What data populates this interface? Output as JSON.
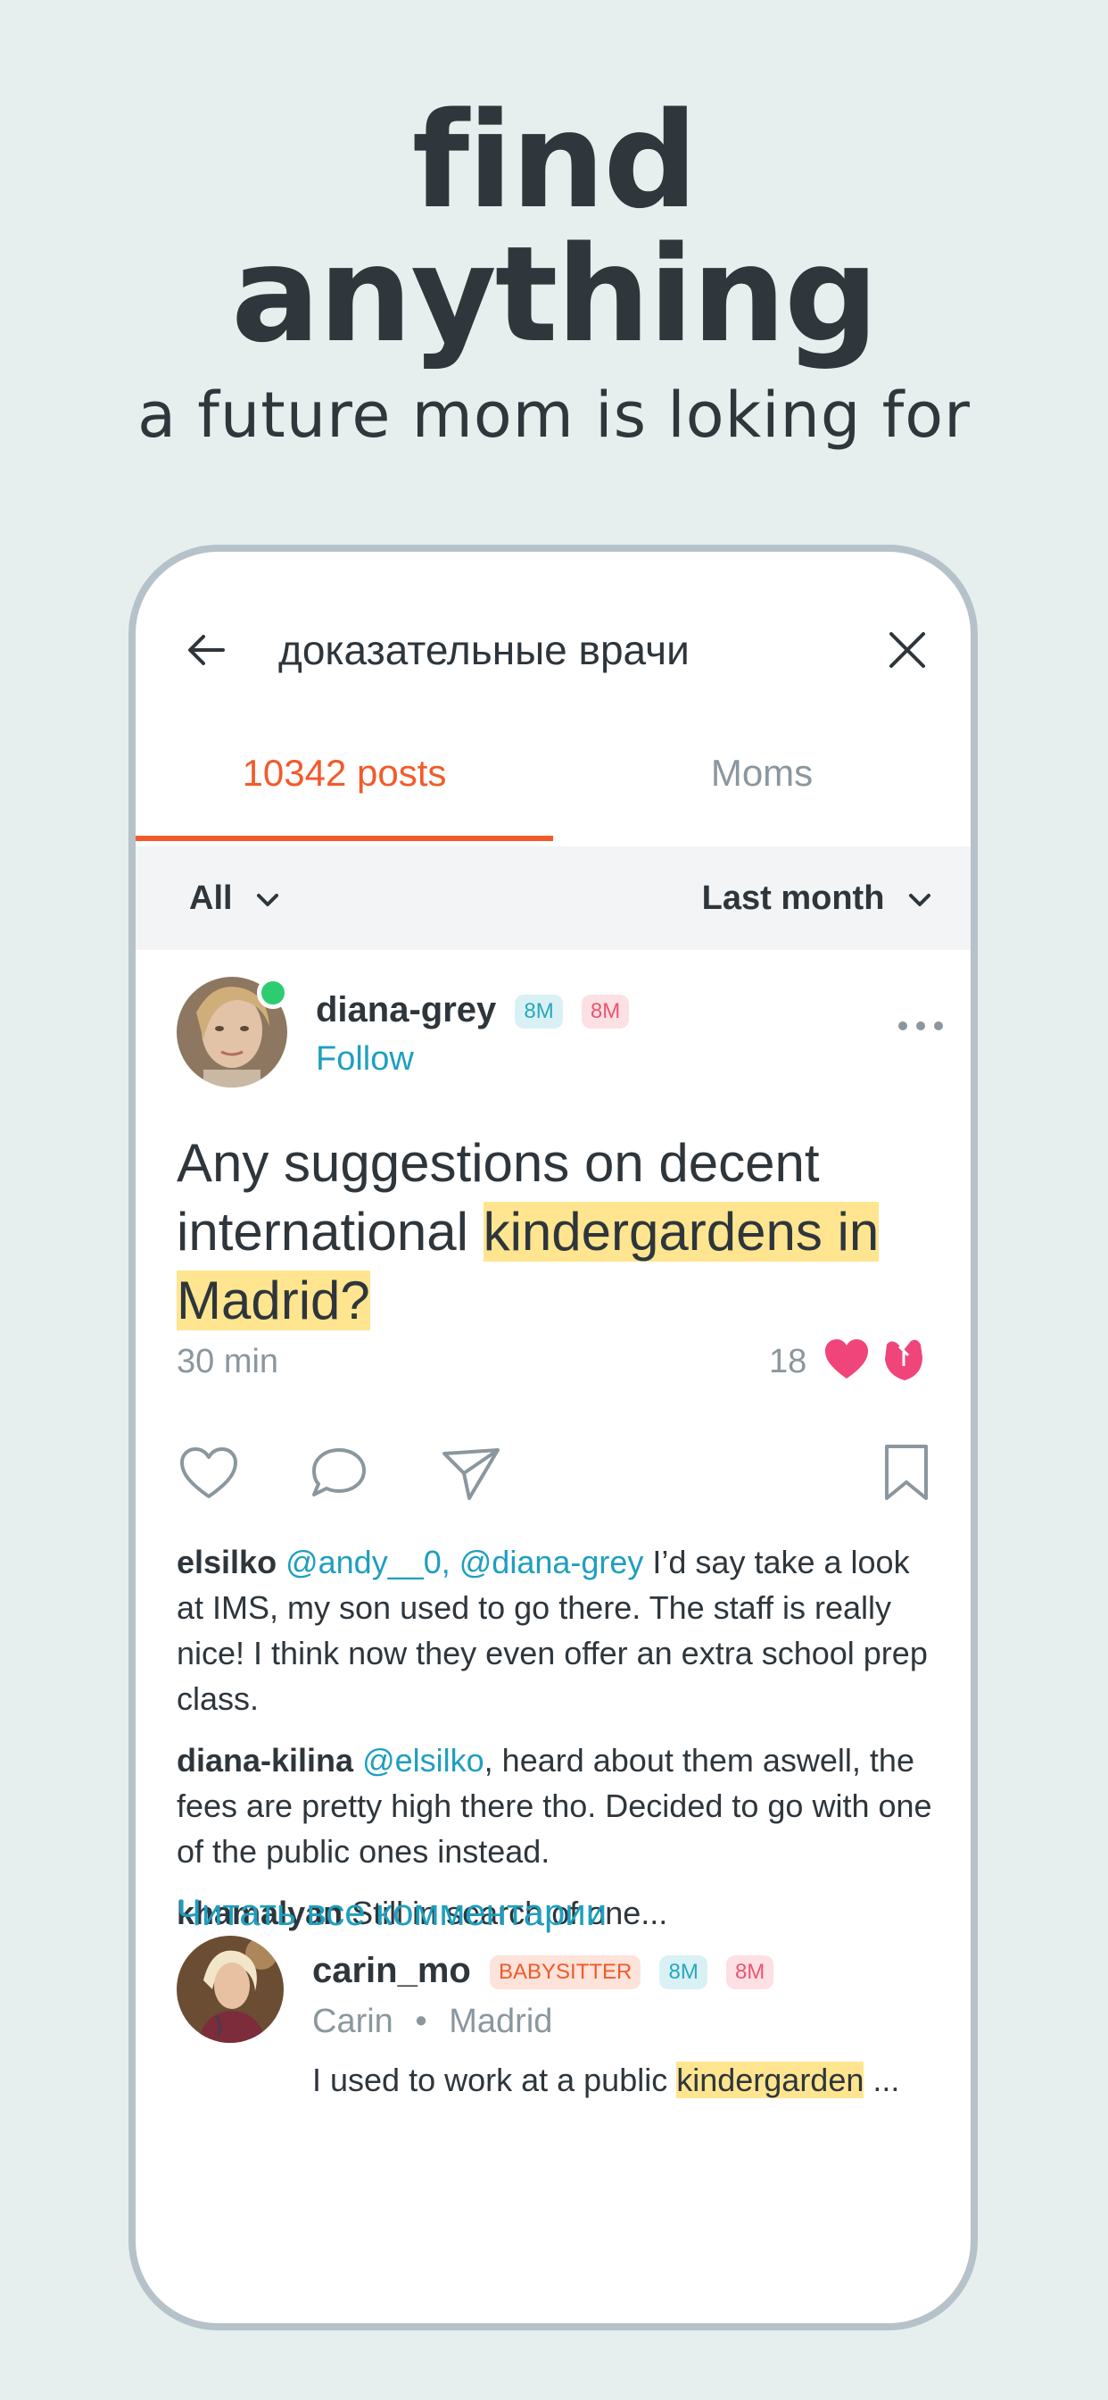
{
  "hero": {
    "line1": "find",
    "line2": "anything",
    "subtitle": "a future mom is loking for"
  },
  "search": {
    "query": "доказательные врачи"
  },
  "tabs": [
    {
      "label": "10342 posts",
      "active": true
    },
    {
      "label": "Moms",
      "active": false
    }
  ],
  "filters": {
    "type": "All",
    "period": "Last month"
  },
  "post": {
    "username": "diana-grey",
    "badges": [
      "8M",
      "8M"
    ],
    "follow_label": "Follow",
    "text_before": "Any suggestions on decent international ",
    "text_highlight": "kindergardens in Madrid?",
    "time": "30 min",
    "reaction_count": "18",
    "comments": [
      {
        "user": "elsilko",
        "mention": "@andy__0, @diana-grey",
        "text": " I’d say take a look at IMS, my son used to go there. The staff is really nice! I think now they even offer an extra school prep class."
      },
      {
        "user": "diana-kilina",
        "mention": "@elsilko",
        "text": ", heard about them aswell, the fees are pretty high there tho. Decided to go with one of the public ones instead."
      },
      {
        "user": "khamalyan",
        "mention": "",
        "text": " Still in search of one..."
      }
    ],
    "read_all_label": "Читать все комментарии"
  },
  "post2": {
    "username": "carin_mo",
    "badges": [
      "BABYSITTER",
      "8M",
      "8M"
    ],
    "name": "Carin",
    "separator": "•",
    "location": "Madrid",
    "preview_before": "I used to work at a public ",
    "preview_highlight": "kindergarden",
    "preview_after": " ..."
  },
  "colors": {
    "accent": "#f35a2a",
    "link": "#1e9fbf",
    "highlight": "#ffe58f",
    "background": "#e6efee"
  }
}
